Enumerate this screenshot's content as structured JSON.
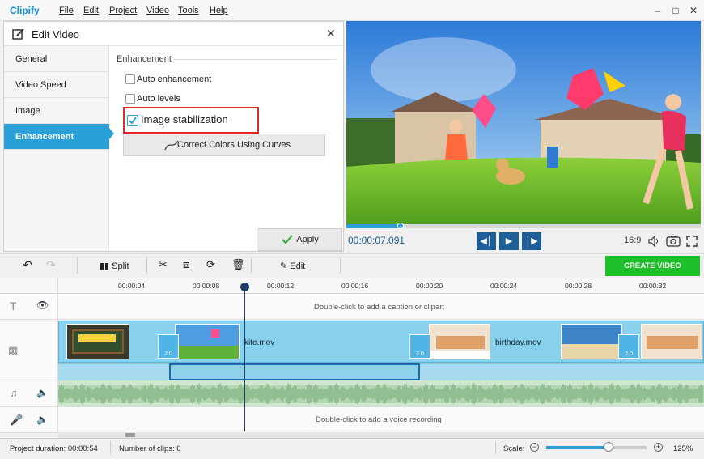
{
  "app": {
    "logo": "Clipify",
    "menu": [
      "File",
      "Edit",
      "Project",
      "Video",
      "Tools",
      "Help"
    ],
    "window_controls": [
      "minimize",
      "maximize",
      "close"
    ]
  },
  "edit_panel": {
    "title": "Edit Video",
    "tabs": [
      {
        "label": "General",
        "active": false
      },
      {
        "label": "Video Speed",
        "active": false
      },
      {
        "label": "Image",
        "active": false
      },
      {
        "label": "Enhancement",
        "active": true
      }
    ],
    "section": "Enhancement",
    "options": [
      {
        "label": "Auto enhancement",
        "checked": false
      },
      {
        "label": "Auto levels",
        "checked": false
      },
      {
        "label": "Image stabilization",
        "checked": true
      }
    ],
    "curves_button": "Correct Colors Using Curves",
    "apply_button": "Apply"
  },
  "player": {
    "timecode": "00:00:07.091",
    "progress": 0.153,
    "aspect": "16:9"
  },
  "toolbar": {
    "split": "Split",
    "edit": "Edit",
    "create": "CREATE VIDEO"
  },
  "ruler": {
    "ticks": [
      "00:00:04",
      "00:00:08",
      "00:00:12",
      "00:00:16",
      "00:00:20",
      "00:00:24",
      "00:00:28",
      "00:00:32"
    ]
  },
  "tracks": {
    "caption_hint": "Double-click to add a caption or clipart",
    "voice_hint": "Double-click to add a voice recording",
    "clips": [
      "kite.mov",
      "birthday.mov"
    ],
    "transition_label": "2.0"
  },
  "status": {
    "duration_label": "Project duration:",
    "duration": "00:00:54",
    "clips_label": "Number of clips:",
    "clips": "6",
    "scale_label": "Scale:",
    "zoom": "125%",
    "zoom_level": 0.62
  },
  "colors": {
    "accent": "#2a9fd8",
    "create": "#1ec02a",
    "highlight": "#e32626"
  }
}
